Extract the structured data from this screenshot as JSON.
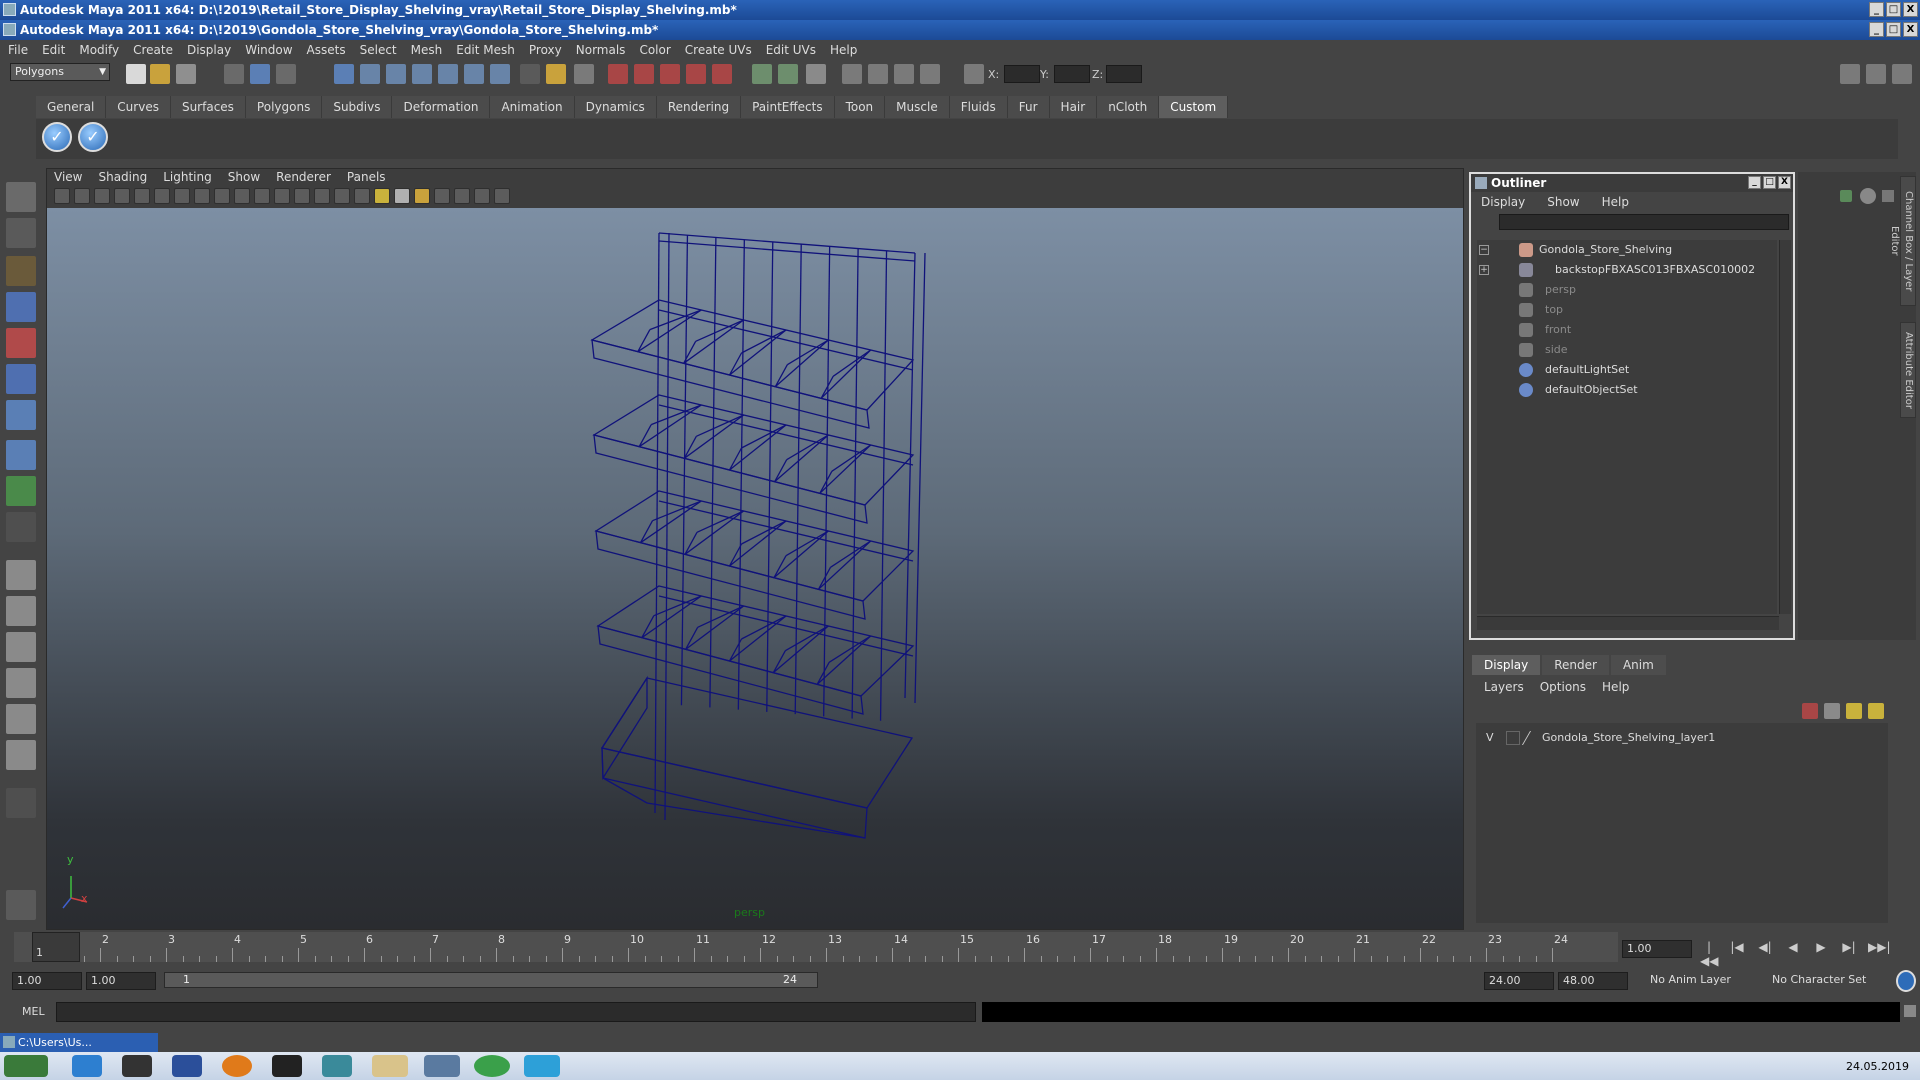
{
  "windows": {
    "title_back": "Autodesk Maya 2011 x64: D:\\!2019\\Retail_Store_Display_Shelving_vray\\Retail_Store_Display_Shelving.mb*",
    "title_front": "Autodesk Maya 2011 x64: D:\\!2019\\Gondola_Store_Shelving_vray\\Gondola_Store_Shelving.mb*",
    "btn_min": "_",
    "btn_max": "□",
    "btn_close": "X"
  },
  "menubar": [
    "File",
    "Edit",
    "Modify",
    "Create",
    "Display",
    "Window",
    "Assets",
    "Select",
    "Mesh",
    "Edit Mesh",
    "Proxy",
    "Normals",
    "Color",
    "Create UVs",
    "Edit UVs",
    "Help"
  ],
  "toolbar": {
    "mode_select": "Polygons",
    "x_label": "X:",
    "y_label": "Y:",
    "z_label": "Z:"
  },
  "shelf": {
    "tabs": [
      "General",
      "Curves",
      "Surfaces",
      "Polygons",
      "Subdivs",
      "Deformation",
      "Animation",
      "Dynamics",
      "Rendering",
      "PaintEffects",
      "Toon",
      "Muscle",
      "Fluids",
      "Fur",
      "Hair",
      "nCloth",
      "Custom"
    ],
    "active_tab": "Custom"
  },
  "viewport": {
    "menu": [
      "View",
      "Shading",
      "Lighting",
      "Show",
      "Renderer",
      "Panels"
    ],
    "camera_label": "persp",
    "axis_y": "y",
    "axis_x": "x",
    "wire_color": "#10127a"
  },
  "outliner": {
    "title": "Outliner",
    "menu": [
      "Display",
      "Show",
      "Help"
    ],
    "items": [
      {
        "label": "Gondola_Store_Shelving",
        "icon": "transform-icon",
        "dim": false
      },
      {
        "label": "backstopFBXASC013FBXASC010002",
        "icon": "mesh-icon",
        "dim": false
      },
      {
        "label": "persp",
        "icon": "camera-icon",
        "dim": true
      },
      {
        "label": "top",
        "icon": "camera-icon",
        "dim": true
      },
      {
        "label": "front",
        "icon": "camera-icon",
        "dim": true
      },
      {
        "label": "side",
        "icon": "camera-icon",
        "dim": true
      },
      {
        "label": "defaultLightSet",
        "icon": "set-icon",
        "dim": false
      },
      {
        "label": "defaultObjectSet",
        "icon": "set-icon",
        "dim": false
      }
    ]
  },
  "side_tabs": {
    "channel_box": "Channel Box / Layer Editor",
    "attribute_editor": "Attribute Editor"
  },
  "layers": {
    "tabs": [
      "Display",
      "Render",
      "Anim"
    ],
    "active_tab": "Display",
    "menu": [
      "Layers",
      "Options",
      "Help"
    ],
    "layer_visibility": "V",
    "layer_name": "Gondola_Store_Shelving_layer1"
  },
  "timeline": {
    "ticks": [
      "1",
      "2",
      "3",
      "4",
      "5",
      "6",
      "7",
      "8",
      "9",
      "10",
      "11",
      "12",
      "13",
      "14",
      "15",
      "16",
      "17",
      "18",
      "19",
      "20",
      "21",
      "22",
      "23",
      "24"
    ],
    "current_frame": "1",
    "current_time_field": "1.00"
  },
  "range": {
    "start_time": "1.00",
    "playback_start": "1.00",
    "range_start_label": "1",
    "range_end_label": "24",
    "playback_end": "24.00",
    "end_time": "48.00",
    "anim_layer": "No Anim Layer",
    "character_set": "No Character Set"
  },
  "command_line": {
    "label": "MEL"
  },
  "taskbar": {
    "mini_window": "C:\\Users\\Us...",
    "date": "24.05.2019"
  }
}
